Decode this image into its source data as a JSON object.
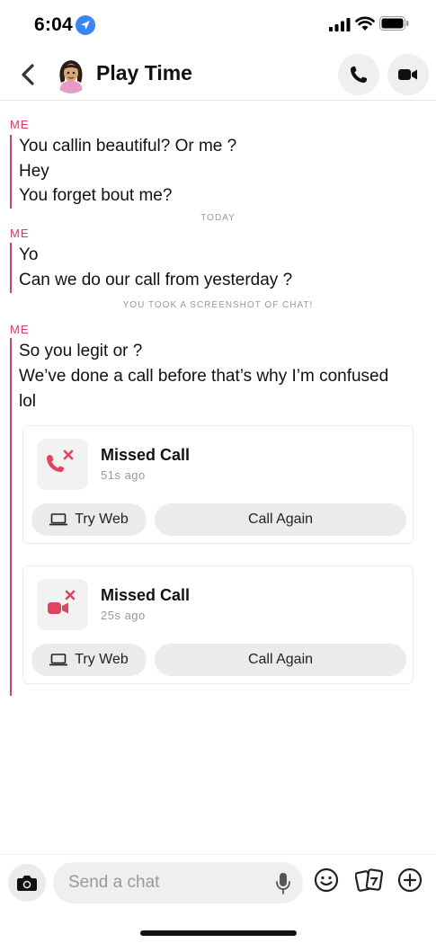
{
  "status_bar": {
    "time": "6:04",
    "icons": [
      "location-arrow-icon",
      "signal-icon",
      "wifi-icon",
      "battery-icon"
    ]
  },
  "header": {
    "title": "Play Time",
    "icons": [
      "back-icon",
      "avatar",
      "phone-icon",
      "video-icon"
    ]
  },
  "chat": {
    "groups": [
      {
        "sender": "ME",
        "messages": [
          "You callin beautiful? Or me ?",
          "Hey",
          "You forget bout me?"
        ]
      },
      {
        "divider": "TODAY"
      },
      {
        "sender": "ME",
        "messages": [
          "Yo",
          "Can we do our call from yesterday ?"
        ]
      },
      {
        "divider": "YOU TOOK A SCREENSHOT OF CHAT!"
      },
      {
        "sender": "ME",
        "messages": [
          "So you legit or ?",
          "We’ve done a call before that’s why I’m confused",
          "lol"
        ]
      }
    ],
    "calls": [
      {
        "kind": "voice",
        "title": "Missed Call",
        "time": "51s ago",
        "try_web_label": "Try Web",
        "call_again_label": "Call Again"
      },
      {
        "kind": "video",
        "title": "Missed Call",
        "time": "25s ago",
        "try_web_label": "Try Web",
        "call_again_label": "Call Again"
      }
    ]
  },
  "composer": {
    "placeholder": "Send a chat",
    "icons": [
      "camera-icon",
      "microphone-icon",
      "emoji-icon",
      "sticker-icon",
      "plus-icon"
    ]
  },
  "colors": {
    "accent_red": "#d4405f",
    "missed_call_red": "#e0455f",
    "location_blue": "#3a86f7",
    "button_gray": "#ebebeb"
  }
}
